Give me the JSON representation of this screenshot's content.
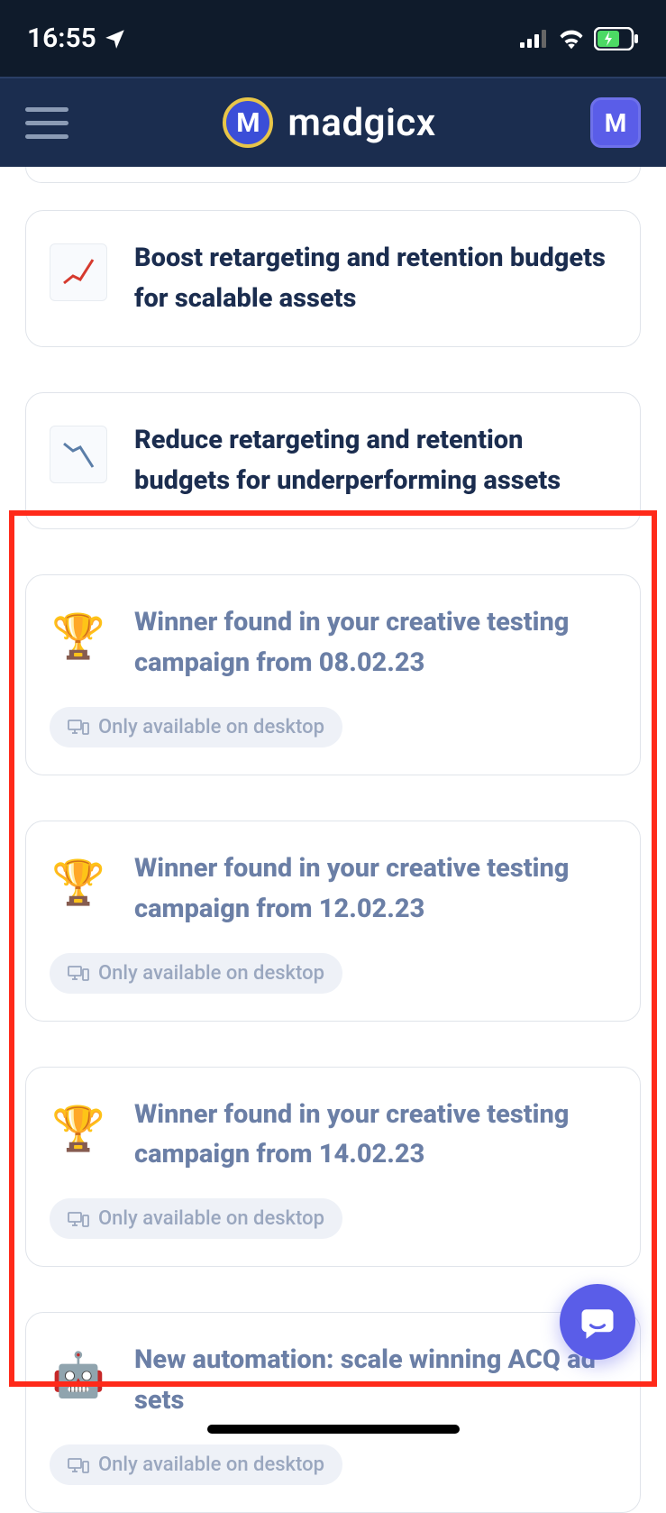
{
  "status_bar": {
    "time": "16:55"
  },
  "header": {
    "brand": "madgicx",
    "logo_letter": "M",
    "square_letter": "M"
  },
  "cards": [
    {
      "title": "Boost retargeting and retention budgets for scalable assets",
      "icon": "chart-up-icon",
      "muted": false,
      "desktop_only": false
    },
    {
      "title": "Reduce retargeting and retention budgets for underperforming assets",
      "icon": "chart-down-icon",
      "muted": false,
      "desktop_only": false
    },
    {
      "title": "Winner found in your creative testing campaign from 08.02.23",
      "icon": "trophy-icon",
      "emoji": "🏆",
      "muted": true,
      "desktop_only": true
    },
    {
      "title": "Winner found in your creative testing campaign from 12.02.23",
      "icon": "trophy-icon",
      "emoji": "🏆",
      "muted": true,
      "desktop_only": true
    },
    {
      "title": "Winner found in your creative testing campaign from 14.02.23",
      "icon": "trophy-icon",
      "emoji": "🏆",
      "muted": true,
      "desktop_only": true
    },
    {
      "title": "New automation: scale winning ACQ ad sets",
      "icon": "robot-icon",
      "emoji": "🤖",
      "muted": true,
      "desktop_only": true
    }
  ],
  "badge_text": "Only available on desktop"
}
